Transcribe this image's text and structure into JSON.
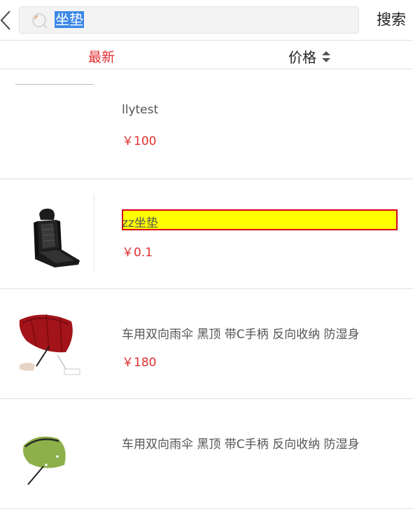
{
  "search": {
    "query": "坐垫",
    "button_label": "搜索"
  },
  "sort": {
    "newest_label": "最新",
    "price_label": "价格"
  },
  "products": [
    {
      "name": "llytest",
      "price": "￥100"
    },
    {
      "name": "zz坐垫",
      "price": "￥0.1"
    },
    {
      "name": "车用双向雨伞 黑顶 带C手柄 反向收纳 防湿身",
      "price": "￥180"
    },
    {
      "name": "车用双向雨伞 黑顶 带C手柄 反向收纳 防湿身",
      "price": ""
    }
  ],
  "colors": {
    "accent_red": "#e03030",
    "highlight_yellow": "#ffff00",
    "highlight_border": "#d6001c",
    "selection_blue": "#3b87e8"
  }
}
